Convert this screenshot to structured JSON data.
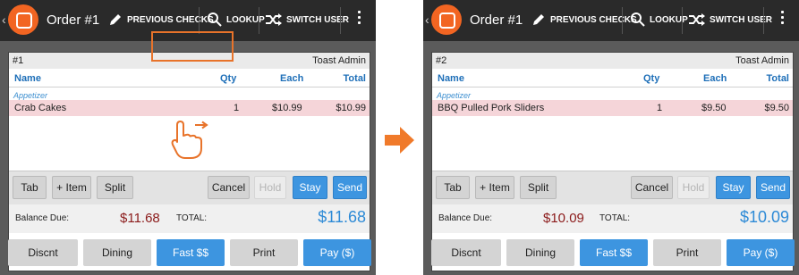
{
  "toolbar": {
    "order_title": "Order #1",
    "previous_checks": "PREVIOUS CHECKS",
    "lookup": "LOOKUP",
    "switch_user": "SWITCH USER"
  },
  "before": {
    "check_number": "#1",
    "server": "Toast Admin",
    "group": "Appetizer",
    "item": {
      "name": "Crab Cakes",
      "qty": "1",
      "each": "$10.99",
      "total": "$10.99"
    },
    "balance_due": "$11.68",
    "total": "$11.68"
  },
  "after": {
    "check_number": "#2",
    "server": "Toast Admin",
    "group": "Appetizer",
    "item": {
      "name": "BBQ Pulled Pork Sliders",
      "qty": "1",
      "each": "$9.50",
      "total": "$9.50"
    },
    "balance_due": "$10.09",
    "total": "$10.09"
  },
  "columns": {
    "name": "Name",
    "qty": "Qty",
    "each": "Each",
    "total": "Total"
  },
  "actions": {
    "tab": "Tab",
    "add_item": "+ Item",
    "split": "Split",
    "cancel": "Cancel",
    "hold": "Hold",
    "stay": "Stay",
    "send": "Send"
  },
  "labels": {
    "balance_due": "Balance Due:",
    "total": "TOTAL:"
  },
  "bottom": {
    "discount": "Discnt",
    "dining": "Dining",
    "fast_cash": "Fast $$",
    "print": "Print",
    "pay": "Pay ($)"
  },
  "colors": {
    "accent_blue": "#3d95e0",
    "brand_orange": "#f26522",
    "item_highlight": "#f5d5d9",
    "due_red": "#8b1a1a",
    "arrow_orange": "#f07a2a"
  },
  "icons": [
    "back-chevron-icon",
    "toast-logo-icon",
    "pencil-icon",
    "magnifier-icon",
    "shuffle-icon",
    "kebab-menu-icon",
    "swipe-hand-icon",
    "right-arrow-icon"
  ]
}
